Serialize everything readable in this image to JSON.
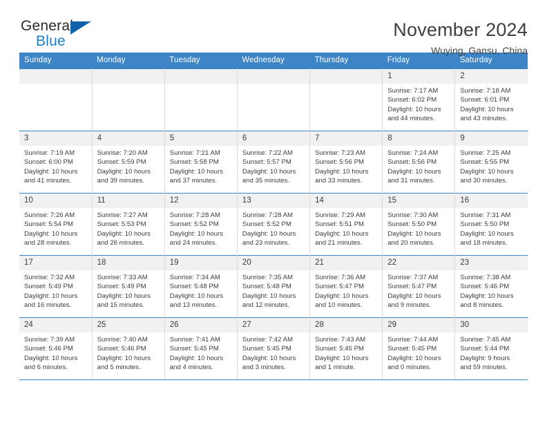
{
  "brand": {
    "name_top": "General",
    "name_bottom": "Blue",
    "accent_color": "#1d7dc4",
    "triangle_color": "#1161a8"
  },
  "header": {
    "month_title": "November 2024",
    "location": "Wuying, Gansu, China",
    "header_bg": "#3d85c6",
    "daynum_bg": "#f1f1f1"
  },
  "weekday_headers": [
    "Sunday",
    "Monday",
    "Tuesday",
    "Wednesday",
    "Thursday",
    "Friday",
    "Saturday"
  ],
  "weeks": [
    [
      {
        "day": "",
        "lines": []
      },
      {
        "day": "",
        "lines": []
      },
      {
        "day": "",
        "lines": []
      },
      {
        "day": "",
        "lines": []
      },
      {
        "day": "",
        "lines": []
      },
      {
        "day": "1",
        "lines": [
          "Sunrise: 7:17 AM",
          "Sunset: 6:02 PM",
          "Daylight: 10 hours",
          "and 44 minutes."
        ]
      },
      {
        "day": "2",
        "lines": [
          "Sunrise: 7:18 AM",
          "Sunset: 6:01 PM",
          "Daylight: 10 hours",
          "and 43 minutes."
        ]
      }
    ],
    [
      {
        "day": "3",
        "lines": [
          "Sunrise: 7:19 AM",
          "Sunset: 6:00 PM",
          "Daylight: 10 hours",
          "and 41 minutes."
        ]
      },
      {
        "day": "4",
        "lines": [
          "Sunrise: 7:20 AM",
          "Sunset: 5:59 PM",
          "Daylight: 10 hours",
          "and 39 minutes."
        ]
      },
      {
        "day": "5",
        "lines": [
          "Sunrise: 7:21 AM",
          "Sunset: 5:58 PM",
          "Daylight: 10 hours",
          "and 37 minutes."
        ]
      },
      {
        "day": "6",
        "lines": [
          "Sunrise: 7:22 AM",
          "Sunset: 5:57 PM",
          "Daylight: 10 hours",
          "and 35 minutes."
        ]
      },
      {
        "day": "7",
        "lines": [
          "Sunrise: 7:23 AM",
          "Sunset: 5:56 PM",
          "Daylight: 10 hours",
          "and 33 minutes."
        ]
      },
      {
        "day": "8",
        "lines": [
          "Sunrise: 7:24 AM",
          "Sunset: 5:56 PM",
          "Daylight: 10 hours",
          "and 31 minutes."
        ]
      },
      {
        "day": "9",
        "lines": [
          "Sunrise: 7:25 AM",
          "Sunset: 5:55 PM",
          "Daylight: 10 hours",
          "and 30 minutes."
        ]
      }
    ],
    [
      {
        "day": "10",
        "lines": [
          "Sunrise: 7:26 AM",
          "Sunset: 5:54 PM",
          "Daylight: 10 hours",
          "and 28 minutes."
        ]
      },
      {
        "day": "11",
        "lines": [
          "Sunrise: 7:27 AM",
          "Sunset: 5:53 PM",
          "Daylight: 10 hours",
          "and 26 minutes."
        ]
      },
      {
        "day": "12",
        "lines": [
          "Sunrise: 7:28 AM",
          "Sunset: 5:52 PM",
          "Daylight: 10 hours",
          "and 24 minutes."
        ]
      },
      {
        "day": "13",
        "lines": [
          "Sunrise: 7:28 AM",
          "Sunset: 5:52 PM",
          "Daylight: 10 hours",
          "and 23 minutes."
        ]
      },
      {
        "day": "14",
        "lines": [
          "Sunrise: 7:29 AM",
          "Sunset: 5:51 PM",
          "Daylight: 10 hours",
          "and 21 minutes."
        ]
      },
      {
        "day": "15",
        "lines": [
          "Sunrise: 7:30 AM",
          "Sunset: 5:50 PM",
          "Daylight: 10 hours",
          "and 20 minutes."
        ]
      },
      {
        "day": "16",
        "lines": [
          "Sunrise: 7:31 AM",
          "Sunset: 5:50 PM",
          "Daylight: 10 hours",
          "and 18 minutes."
        ]
      }
    ],
    [
      {
        "day": "17",
        "lines": [
          "Sunrise: 7:32 AM",
          "Sunset: 5:49 PM",
          "Daylight: 10 hours",
          "and 16 minutes."
        ]
      },
      {
        "day": "18",
        "lines": [
          "Sunrise: 7:33 AM",
          "Sunset: 5:49 PM",
          "Daylight: 10 hours",
          "and 15 minutes."
        ]
      },
      {
        "day": "19",
        "lines": [
          "Sunrise: 7:34 AM",
          "Sunset: 5:48 PM",
          "Daylight: 10 hours",
          "and 13 minutes."
        ]
      },
      {
        "day": "20",
        "lines": [
          "Sunrise: 7:35 AM",
          "Sunset: 5:48 PM",
          "Daylight: 10 hours",
          "and 12 minutes."
        ]
      },
      {
        "day": "21",
        "lines": [
          "Sunrise: 7:36 AM",
          "Sunset: 5:47 PM",
          "Daylight: 10 hours",
          "and 10 minutes."
        ]
      },
      {
        "day": "22",
        "lines": [
          "Sunrise: 7:37 AM",
          "Sunset: 5:47 PM",
          "Daylight: 10 hours",
          "and 9 minutes."
        ]
      },
      {
        "day": "23",
        "lines": [
          "Sunrise: 7:38 AM",
          "Sunset: 5:46 PM",
          "Daylight: 10 hours",
          "and 8 minutes."
        ]
      }
    ],
    [
      {
        "day": "24",
        "lines": [
          "Sunrise: 7:39 AM",
          "Sunset: 5:46 PM",
          "Daylight: 10 hours",
          "and 6 minutes."
        ]
      },
      {
        "day": "25",
        "lines": [
          "Sunrise: 7:40 AM",
          "Sunset: 5:46 PM",
          "Daylight: 10 hours",
          "and 5 minutes."
        ]
      },
      {
        "day": "26",
        "lines": [
          "Sunrise: 7:41 AM",
          "Sunset: 5:45 PM",
          "Daylight: 10 hours",
          "and 4 minutes."
        ]
      },
      {
        "day": "27",
        "lines": [
          "Sunrise: 7:42 AM",
          "Sunset: 5:45 PM",
          "Daylight: 10 hours",
          "and 3 minutes."
        ]
      },
      {
        "day": "28",
        "lines": [
          "Sunrise: 7:43 AM",
          "Sunset: 5:45 PM",
          "Daylight: 10 hours",
          "and 1 minute."
        ]
      },
      {
        "day": "29",
        "lines": [
          "Sunrise: 7:44 AM",
          "Sunset: 5:45 PM",
          "Daylight: 10 hours",
          "and 0 minutes."
        ]
      },
      {
        "day": "30",
        "lines": [
          "Sunrise: 7:45 AM",
          "Sunset: 5:44 PM",
          "Daylight: 9 hours",
          "and 59 minutes."
        ]
      }
    ]
  ]
}
